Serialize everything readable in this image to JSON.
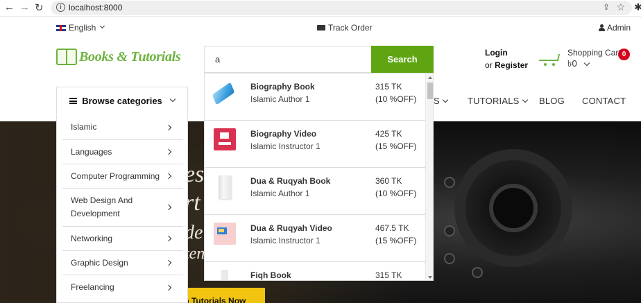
{
  "browser": {
    "url": "localhost:8000"
  },
  "topbar": {
    "language": "English",
    "track_order": "Track Order",
    "admin": "Admin"
  },
  "header": {
    "logo_text": "Books & Tutorials",
    "search": {
      "value": "a",
      "button": "Search"
    },
    "login": "Login",
    "or": "or",
    "register": "Register",
    "cart_label": "Shopping Cart",
    "cart_amount": "৳0",
    "cart_count": "0"
  },
  "nav": {
    "browse": "Browse categories",
    "items": [
      {
        "label": "S"
      },
      {
        "label": "TUTORIALS"
      },
      {
        "label": "BLOG"
      },
      {
        "label": "CONTACT"
      }
    ]
  },
  "categories": [
    {
      "label": "Islamic"
    },
    {
      "label": "Languages"
    },
    {
      "label": "Computer Programming"
    },
    {
      "label": "Web Design And Development"
    },
    {
      "label": "Networking"
    },
    {
      "label": "Graphic Design"
    },
    {
      "label": "Freelancing"
    }
  ],
  "search_results": [
    {
      "title": "Biography Book",
      "author": "Islamic Author 1",
      "price": "315 TK",
      "discount": "(10 %OFF)",
      "thumb": "blue-book"
    },
    {
      "title": "Biography Video",
      "author": "Islamic Instructor 1",
      "price": "425 TK",
      "discount": "(15 %OFF)",
      "thumb": "video-red"
    },
    {
      "title": "Dua & Ruqyah Book",
      "author": "Islamic Author 1",
      "price": "360 TK",
      "discount": "(10 %OFF)",
      "thumb": "white-book"
    },
    {
      "title": "Dua & Ruqyah Video",
      "author": "Islamic Instructor 1",
      "price": "467.5 TK",
      "discount": "(15 %OFF)",
      "thumb": "video-pink"
    },
    {
      "title": "Fiqh Book",
      "author": "",
      "price": "315 TK",
      "discount": "",
      "thumb": "white-book"
    }
  ],
  "hero": {
    "words": [
      "es",
      "rt",
      "de",
      "ten"
    ],
    "button": "Shop Tutorials Now"
  },
  "colors": {
    "brand_green": "#5fa512",
    "badge_red": "#d6001c",
    "hero_button": "#f1c40f"
  }
}
